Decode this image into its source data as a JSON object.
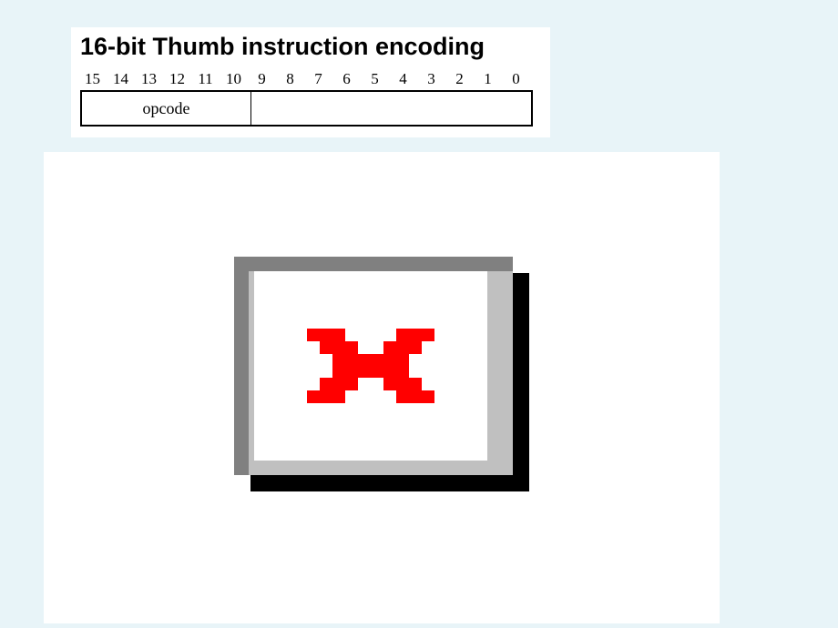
{
  "title": "16-bit Thumb instruction encoding",
  "bits": [
    "15",
    "14",
    "13",
    "12",
    "11",
    "10",
    "9",
    "8",
    "7",
    "6",
    "5",
    "4",
    "3",
    "2",
    "1",
    "0"
  ],
  "opcode_label": "opcode"
}
